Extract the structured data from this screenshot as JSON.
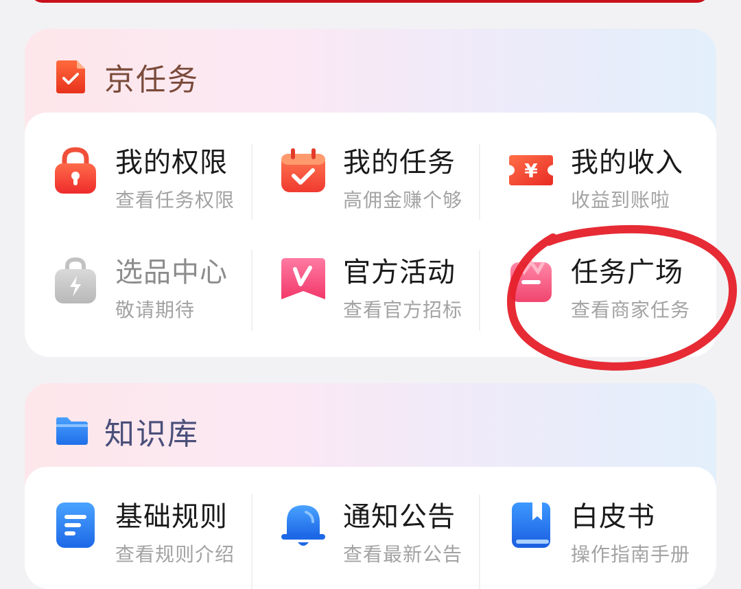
{
  "jd_tasks": {
    "title": "京任务",
    "items": [
      {
        "title": "我的权限",
        "subtitle": "查看任务权限",
        "icon": "lock-icon"
      },
      {
        "title": "我的任务",
        "subtitle": "高佣金赚个够",
        "icon": "calendar-check-icon"
      },
      {
        "title": "我的收入",
        "subtitle": "收益到账啦",
        "icon": "yen-ticket-icon"
      },
      {
        "title": "选品中心",
        "subtitle": "敬请期待",
        "icon": "shopping-bag-icon",
        "disabled": true
      },
      {
        "title": "官方活动",
        "subtitle": "查看官方招标",
        "icon": "v-badge-icon"
      },
      {
        "title": "任务广场",
        "subtitle": "查看商家任务",
        "icon": "storefront-icon"
      }
    ]
  },
  "knowledge_base": {
    "title": "知识库",
    "items": [
      {
        "title": "基础规则",
        "subtitle": "查看规则介绍",
        "icon": "document-icon"
      },
      {
        "title": "通知公告",
        "subtitle": "查看最新公告",
        "icon": "bell-icon"
      },
      {
        "title": "白皮书",
        "subtitle": "操作指南手册",
        "icon": "book-icon"
      }
    ]
  },
  "colors": {
    "annotation_red": "#e5202a",
    "accent_orange": "#f5452c",
    "accent_blue": "#2f7cf6"
  }
}
